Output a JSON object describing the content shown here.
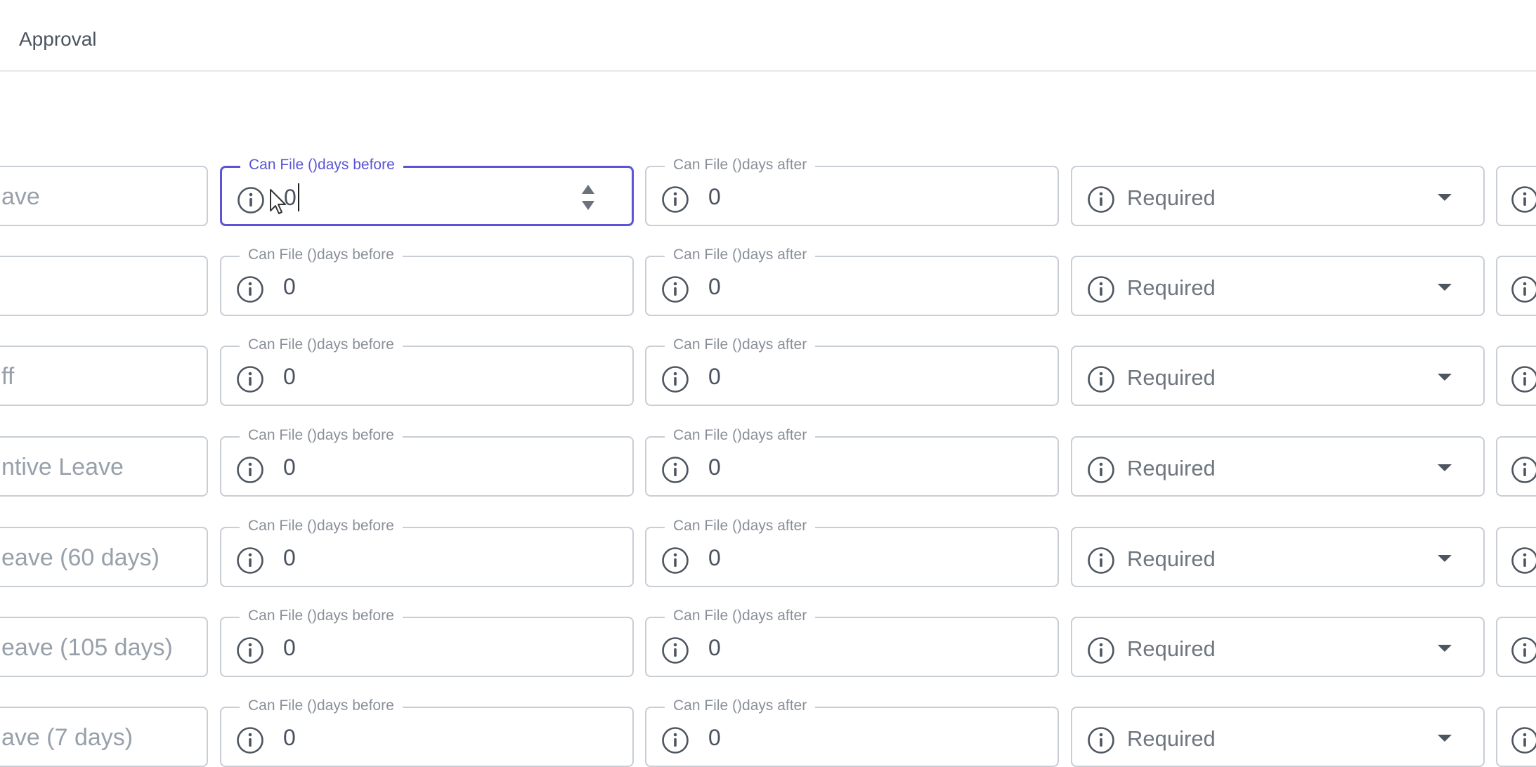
{
  "header": {
    "tab_label": "Approval"
  },
  "legends": {
    "before": "Can File ()days before",
    "after": "Can File ()days after"
  },
  "icons": {
    "info": "info-icon",
    "dropdown": "chevron-down-icon",
    "spinner": "number-spinner-icon"
  },
  "accent_color": "#5b55d6",
  "rows": [
    {
      "name": "ave",
      "before": "0",
      "after": "0",
      "approval": "Required"
    },
    {
      "name": "",
      "before": "0",
      "after": "0",
      "approval": "Required"
    },
    {
      "name": "ff",
      "before": "0",
      "after": "0",
      "approval": "Required"
    },
    {
      "name": "ntive Leave",
      "before": "0",
      "after": "0",
      "approval": "Required"
    },
    {
      "name": "eave (60 days)",
      "before": "0",
      "after": "0",
      "approval": "Required"
    },
    {
      "name": "eave (105 days)",
      "before": "0",
      "after": "0",
      "approval": "Required"
    },
    {
      "name": "ave (7 days)",
      "before": "0",
      "after": "0",
      "approval": "Required"
    }
  ]
}
